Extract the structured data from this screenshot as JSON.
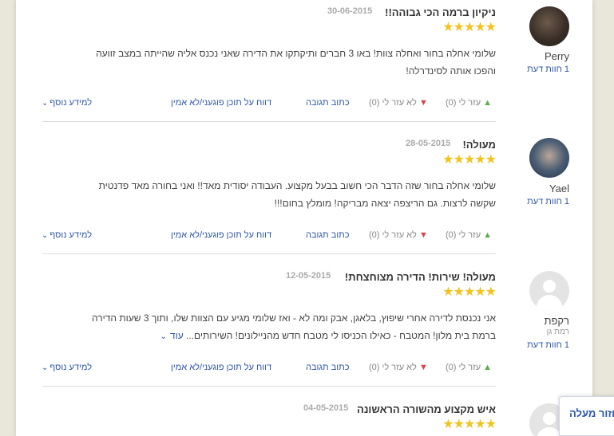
{
  "reviews": [
    {
      "user": "Perry",
      "location": "",
      "count": "1 חוות דעת",
      "title": "ניקיון ברמה הכי גבוהה!!",
      "date": "30-06-2015",
      "rating": "5/5",
      "line1": "שלומי אחלה בחור ואחלה צוות! באו 3 חברים ותיקתקו את הדירה שאני נכנס אליה שהייתה במצב זוועה",
      "line2": "והפכו אותה לסינדרלה!",
      "more": "",
      "helpful": "עזר לי (0)",
      "not_helpful": "לא עזר לי (0)",
      "reply": "כתוב תגובה",
      "report": "דווח על תוכן פוגעני/לא אמין",
      "more_info": "למידע נוסף"
    },
    {
      "user": "Yael",
      "location": "",
      "count": "1 חוות דעת",
      "title": "מעולה!",
      "date": "28-05-2015",
      "rating": "5/5",
      "line1": "שלומי אחלה בחור שזה הדבר הכי חשוב בבעל מקצוע. העבודה יסודית מאד!! ואני בחורה מאד פדנטית",
      "line2": "שקשה לרצות. גם הריצפה יצאה מבריקה! מומלץ בחום!!!",
      "more": "",
      "helpful": "עזר לי (0)",
      "not_helpful": "לא עזר לי (0)",
      "reply": "כתוב תגובה",
      "report": "דווח על תוכן פוגעני/לא אמין",
      "more_info": "למידע נוסף"
    },
    {
      "user": "רקפת",
      "location": "רמת גן",
      "count": "1 חוות דעת",
      "title": "מעולה! שירות! הדירה מצוחצחת!",
      "date": "12-05-2015",
      "rating": "5/5",
      "line1": "אני נכנסת לדירה אחרי שיפוץ, בלאגן, אבק ומה לא - ואז שלומי מגיע עם הצוות שלו, ותוך 3 שעות הדירה",
      "line2": "ברמת בית מלון! המטבח - כאילו הכניסו לי מטבח חדש מהניילונים! השירותים...",
      "more": "עוד",
      "helpful": "עזר לי (0)",
      "not_helpful": "לא עזר לי (0)",
      "reply": "כתוב תגובה",
      "report": "דווח על תוכן פוגעני/לא אמין",
      "more_info": "למידע נוסף"
    },
    {
      "user": "",
      "location": "",
      "count": "",
      "title": "איש מקצוע מהשורה הראשונה",
      "date": "04-05-2015",
      "rating": "5/5"
    }
  ],
  "back_to_top": "חזור מעלה",
  "colors": {
    "link": "#2b56a8",
    "star": "#f0c420",
    "helpful": "#5cae4a",
    "not_helpful": "#d9434a"
  }
}
